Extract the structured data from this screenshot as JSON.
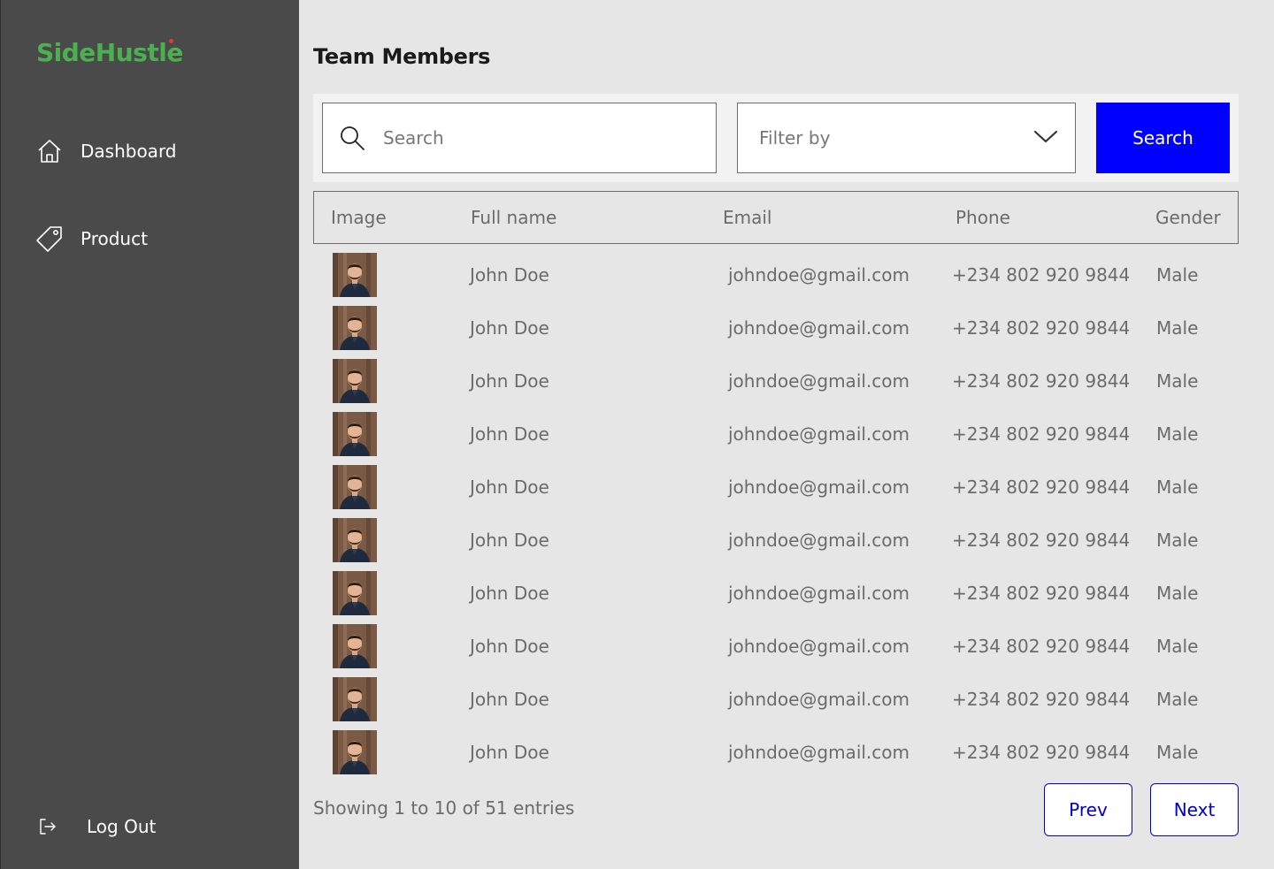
{
  "app": {
    "logo_text": "SideHustle"
  },
  "sidebar": {
    "items": [
      {
        "label": "Dashboard",
        "icon": "home-icon"
      },
      {
        "label": "Product",
        "icon": "tag-icon"
      }
    ],
    "logout": {
      "label": "Log Out",
      "icon": "logout-icon"
    }
  },
  "main": {
    "title": "Team Members",
    "search": {
      "placeholder": "Search",
      "value": ""
    },
    "filter": {
      "label": "Filter by"
    },
    "search_button": "Search",
    "table": {
      "columns": [
        "Image",
        "Full name",
        "Email",
        "Phone",
        "Gender"
      ],
      "rows": [
        {
          "name": "John Doe",
          "email": "johndoe@gmail.com",
          "phone": "+234 802 920 9844",
          "gender": "Male"
        },
        {
          "name": "John Doe",
          "email": "johndoe@gmail.com",
          "phone": "+234 802 920 9844",
          "gender": "Male"
        },
        {
          "name": "John Doe",
          "email": "johndoe@gmail.com",
          "phone": "+234 802 920 9844",
          "gender": "Male"
        },
        {
          "name": "John Doe",
          "email": "johndoe@gmail.com",
          "phone": "+234 802 920 9844",
          "gender": "Male"
        },
        {
          "name": "John Doe",
          "email": "johndoe@gmail.com",
          "phone": "+234 802 920 9844",
          "gender": "Male"
        },
        {
          "name": "John Doe",
          "email": "johndoe@gmail.com",
          "phone": "+234 802 920 9844",
          "gender": "Male"
        },
        {
          "name": "John Doe",
          "email": "johndoe@gmail.com",
          "phone": "+234 802 920 9844",
          "gender": "Male"
        },
        {
          "name": "John Doe",
          "email": "johndoe@gmail.com",
          "phone": "+234 802 920 9844",
          "gender": "Male"
        },
        {
          "name": "John Doe",
          "email": "johndoe@gmail.com",
          "phone": "+234 802 920 9844",
          "gender": "Male"
        },
        {
          "name": "John Doe",
          "email": "johndoe@gmail.com",
          "phone": "+234 802 920 9844",
          "gender": "Male"
        }
      ]
    },
    "pagination": {
      "summary": "Showing 1 to 10 of 51 entries",
      "prev": "Prev",
      "next": "Next"
    }
  },
  "colors": {
    "sidebar_bg": "#4a4a4a",
    "page_bg": "#e6e6e6",
    "brand_green": "#4caf50",
    "primary_blue": "#0000ff"
  }
}
